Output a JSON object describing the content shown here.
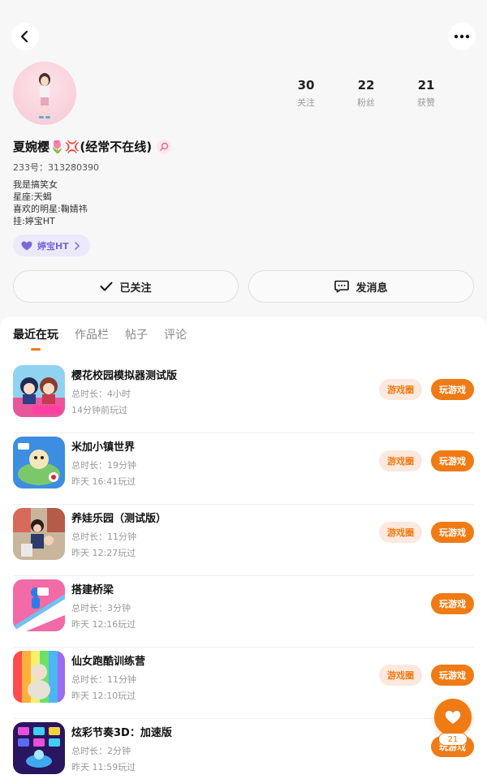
{
  "header": {
    "back_icon": "back-arrow-icon",
    "more_icon": "more-dots-icon"
  },
  "profile": {
    "nickname": "夏婉樱🌷💢(经常不在线)",
    "uid": "233号：313280390",
    "bio": [
      "我是搞笑女",
      "星座:天蝎",
      "喜欢的明星:鞠婧祎",
      "挂:婷宝HT"
    ],
    "stats": [
      {
        "value": "30",
        "label": "关注"
      },
      {
        "value": "22",
        "label": "粉丝"
      },
      {
        "value": "21",
        "label": "获赞"
      }
    ],
    "tag": "婷宝HT"
  },
  "actions": {
    "follow_label": "已关注",
    "message_label": "发消息"
  },
  "tabs": [
    {
      "label": "最近在玩",
      "active": true
    },
    {
      "label": "作品栏",
      "active": false
    },
    {
      "label": "帖子",
      "active": false
    },
    {
      "label": "评论",
      "active": false
    }
  ],
  "games": [
    {
      "title": "樱花校园模拟器测试版",
      "duration": "总时长：4小时",
      "last_played": "14分钟前玩过",
      "circle": "游戏圈",
      "play": "玩游戏"
    },
    {
      "title": "米加小镇世界",
      "duration": "总时长：19分钟",
      "last_played": "昨天 16:41玩过",
      "circle": "游戏圈",
      "play": "玩游戏"
    },
    {
      "title": "养娃乐园（测试版）",
      "duration": "总时长：11分钟",
      "last_played": "昨天 12:27玩过",
      "circle": "游戏圈",
      "play": "玩游戏"
    },
    {
      "title": "搭建桥梁",
      "duration": "总时长：3分钟",
      "last_played": "昨天 12:16玩过",
      "circle": "",
      "play": "玩游戏"
    },
    {
      "title": "仙女跑酷训练营",
      "duration": "总时长：11分钟",
      "last_played": "昨天 12:10玩过",
      "circle": "游戏圈",
      "play": "玩游戏"
    },
    {
      "title": "炫彩节奏3D：加速版",
      "duration": "总时长：2分钟",
      "last_played": "昨天 11:59玩过",
      "circle": "",
      "play": "玩游戏"
    }
  ],
  "fab": {
    "icon": "heart-icon",
    "count": "21"
  },
  "colors": {
    "accent": "#f07a14",
    "tag_purple": "#7b68d9"
  }
}
